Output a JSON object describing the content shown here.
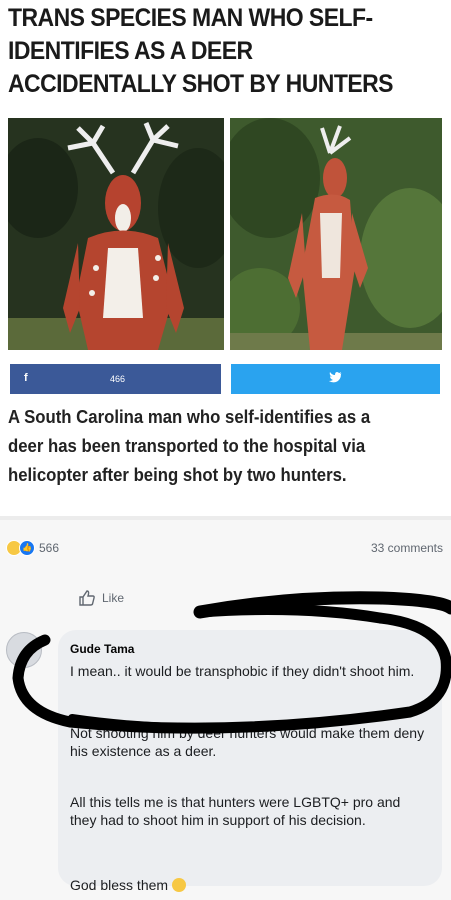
{
  "headline": "TRANS SPECIES MAN WHO SELF-IDENTIFIES AS A DEER ACCIDENTALLY SHOT BY HUNTERS",
  "share": {
    "facebook_icon": "f",
    "facebook_count": "466",
    "twitter_icon": "twitter-bird-icon"
  },
  "summary": "A South Carolina man who self-identifies as a deer has been transported to the hospital via helicopter after being shot by two hunters.",
  "reactions": {
    "count": "566"
  },
  "comments_count": "33 comments",
  "like_label": "Like",
  "comment": {
    "author": "Gude Tama",
    "para1": "I mean.. it would be transphobic if they didn't shoot him.",
    "para2": "Not shooting him by deer hunters would make them deny his existence as a deer.",
    "para3": "All this tells me is that hunters were LGBTQ+ pro and they had to shoot him in support of his decision.",
    "para4": "God bless them"
  },
  "colors": {
    "facebook": "#3b5998",
    "twitter": "#2aa3ef",
    "like_blue": "#1877f2"
  }
}
